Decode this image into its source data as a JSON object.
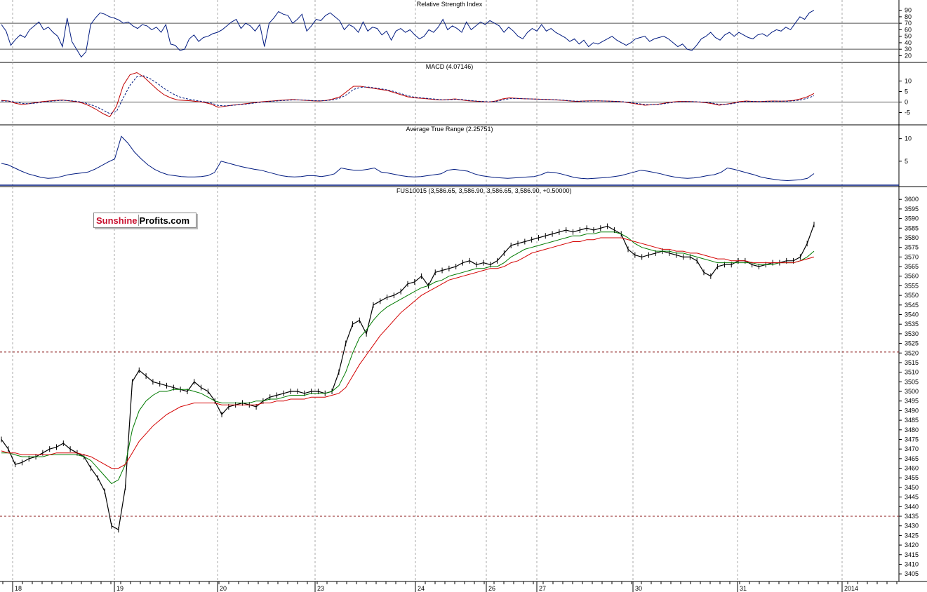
{
  "logo": {
    "part1": "Sunshine",
    "part2": "Profits.com"
  },
  "chart_data": [
    {
      "type": "line",
      "title": "Relative Strength Index",
      "yticks": [
        90,
        80,
        70,
        60,
        50,
        40,
        30,
        20
      ],
      "ylim": [
        14,
        95
      ],
      "reference_lines": [
        70,
        30
      ],
      "series": [
        {
          "values": [
            68,
            58,
            36,
            45,
            52,
            48,
            60,
            66,
            72,
            60,
            64,
            56,
            50,
            34,
            78,
            42,
            30,
            18,
            26,
            68,
            78,
            86,
            84,
            80,
            78,
            75,
            70,
            72,
            66,
            62,
            68,
            66,
            60,
            64,
            56,
            68,
            38,
            36,
            28,
            30,
            46,
            52,
            42,
            48,
            50,
            54,
            56,
            60,
            66,
            72,
            76,
            62,
            70,
            66,
            58,
            68,
            34,
            70,
            78,
            88,
            84,
            82,
            70,
            76,
            84,
            58,
            66,
            76,
            74,
            82,
            86,
            80,
            74,
            60,
            68,
            64,
            56,
            72,
            58,
            64,
            62,
            52,
            58,
            44,
            58,
            62,
            56,
            60,
            52,
            46,
            50,
            60,
            56,
            64,
            76,
            60,
            66,
            62,
            56,
            72,
            60,
            66,
            72,
            68,
            74,
            70,
            66,
            56,
            64,
            58,
            50,
            46,
            56,
            62,
            58,
            68,
            58,
            62,
            56,
            52,
            48,
            42,
            46,
            38,
            44,
            34,
            40,
            38,
            42,
            46,
            50,
            44,
            40,
            36,
            40,
            46,
            48,
            50,
            42,
            46,
            48,
            50,
            46,
            40,
            34,
            38,
            30,
            28,
            36,
            46,
            50,
            56,
            48,
            44,
            52,
            56,
            50,
            56,
            52,
            48,
            46,
            52,
            54,
            50,
            56,
            60,
            58,
            64,
            60,
            70,
            80,
            76,
            86,
            90
          ]
        }
      ]
    },
    {
      "type": "line",
      "title": "MACD (4.07146)",
      "yticks": [
        10,
        5,
        0,
        -5
      ],
      "ylim": [
        -9.5,
        15.5
      ],
      "reference_lines": [
        0
      ],
      "series": [
        {
          "line": "solid",
          "values": [
            0.8,
            0.5,
            -0.5,
            -1.2,
            -0.8,
            -0.3,
            0.2,
            0.5,
            0.8,
            1.0,
            0.6,
            0.2,
            -0.5,
            -1.8,
            -3.5,
            -5.5,
            -7.0,
            -2.0,
            8.0,
            13.0,
            14.0,
            12.0,
            9.0,
            6.0,
            3.5,
            2.0,
            1.0,
            0.8,
            0.6,
            0.2,
            -0.2,
            -1.0,
            -2.5,
            -2.0,
            -1.5,
            -1.2,
            -0.8,
            -0.4,
            0.0,
            0.3,
            0.5,
            0.8,
            1.0,
            1.2,
            1.0,
            0.8,
            0.6,
            0.5,
            0.8,
            1.5,
            2.5,
            5.0,
            7.5,
            7.5,
            7.0,
            6.5,
            6.0,
            5.5,
            4.5,
            3.5,
            2.5,
            2.0,
            1.8,
            1.5,
            1.2,
            1.0,
            1.2,
            1.5,
            1.0,
            0.6,
            0.4,
            0.2,
            0.0,
            0.5,
            1.5,
            2.0,
            1.8,
            1.6,
            1.5,
            1.4,
            1.3,
            1.2,
            1.0,
            0.8,
            0.5,
            0.3,
            0.5,
            0.6,
            0.6,
            0.5,
            0.4,
            0.3,
            0.0,
            -0.5,
            -1.0,
            -1.5,
            -1.3,
            -1.0,
            -0.5,
            0.0,
            0.3,
            0.3,
            0.2,
            0.0,
            -0.3,
            -0.8,
            -1.5,
            -1.0,
            -0.5,
            0.2,
            0.5,
            0.3,
            0.2,
            0.4,
            0.5,
            0.4,
            0.5,
            0.8,
            1.5,
            2.5,
            4.07
          ]
        },
        {
          "line": "dashed",
          "values": [
            0.5,
            0.5,
            0.0,
            -0.6,
            -0.8,
            -0.5,
            -0.1,
            0.3,
            0.6,
            0.8,
            0.7,
            0.4,
            -0.1,
            -1.0,
            -2.2,
            -3.8,
            -5.5,
            -4.5,
            2.0,
            8.0,
            12.0,
            12.5,
            11.0,
            9.0,
            6.5,
            4.5,
            2.8,
            1.8,
            1.2,
            0.6,
            0.1,
            -0.5,
            -1.6,
            -1.8,
            -1.6,
            -1.3,
            -1.0,
            -0.6,
            -0.2,
            0.1,
            0.4,
            0.6,
            0.8,
            1.0,
            1.0,
            0.9,
            0.7,
            0.6,
            0.7,
            1.1,
            1.9,
            3.5,
            6.0,
            7.0,
            7.2,
            6.8,
            6.3,
            5.8,
            5.0,
            4.0,
            3.0,
            2.3,
            2.0,
            1.7,
            1.4,
            1.1,
            1.1,
            1.3,
            1.2,
            0.8,
            0.5,
            0.3,
            0.1,
            0.3,
            1.0,
            1.6,
            1.7,
            1.6,
            1.5,
            1.4,
            1.3,
            1.2,
            1.1,
            0.9,
            0.6,
            0.4,
            0.4,
            0.5,
            0.6,
            0.5,
            0.4,
            0.3,
            0.1,
            -0.3,
            -0.7,
            -1.2,
            -1.3,
            -1.1,
            -0.7,
            -0.2,
            0.1,
            0.2,
            0.2,
            0.1,
            -0.1,
            -0.5,
            -1.1,
            -1.1,
            -0.7,
            -0.1,
            0.3,
            0.3,
            0.2,
            0.3,
            0.4,
            0.4,
            0.4,
            0.6,
            1.0,
            1.8,
            3.0
          ]
        }
      ]
    },
    {
      "type": "line",
      "title": "Average True Range (2.25751)",
      "yticks": [
        10,
        5
      ],
      "ylim": [
        0,
        11.5
      ],
      "series": [
        {
          "values": [
            4.5,
            4.2,
            3.5,
            2.8,
            2.2,
            1.8,
            1.4,
            1.2,
            1.3,
            1.6,
            2.0,
            2.2,
            2.4,
            2.6,
            3.2,
            4.0,
            4.8,
            5.5,
            10.5,
            9.0,
            7.0,
            5.5,
            4.2,
            3.2,
            2.5,
            2.0,
            1.8,
            1.6,
            1.5,
            1.5,
            1.6,
            1.8,
            2.5,
            5.0,
            4.6,
            4.2,
            3.8,
            3.5,
            3.2,
            3.0,
            2.6,
            2.2,
            1.8,
            1.6,
            1.5,
            1.6,
            1.8,
            1.8,
            1.6,
            1.8,
            2.2,
            3.5,
            3.2,
            3.0,
            3.0,
            3.2,
            3.5,
            2.6,
            2.4,
            2.1,
            1.8,
            1.6,
            1.5,
            1.6,
            1.8,
            2.0,
            2.2,
            3.0,
            3.2,
            3.0,
            2.8,
            2.2,
            1.8,
            1.6,
            1.4,
            1.3,
            1.2,
            1.3,
            1.4,
            1.5,
            1.6,
            2.0,
            2.6,
            2.5,
            2.2,
            1.8,
            1.4,
            1.2,
            1.1,
            1.2,
            1.3,
            1.4,
            1.6,
            1.8,
            2.2,
            2.6,
            3.0,
            2.8,
            2.5,
            2.2,
            1.8,
            1.5,
            1.3,
            1.2,
            1.3,
            1.5,
            1.8,
            2.0,
            2.5,
            3.5,
            3.2,
            2.8,
            2.4,
            2.0,
            1.5,
            1.2,
            1.0,
            0.8,
            0.7,
            0.8,
            0.9,
            1.2,
            2.26
          ]
        }
      ]
    },
    {
      "type": "line",
      "title": "FUS10015 (3,586.65, 3,586.90, 3,586.65, 3,586.90, +0.50000)",
      "yticks": [
        3600,
        3595,
        3590,
        3585,
        3580,
        3575,
        3570,
        3565,
        3560,
        3555,
        3550,
        3545,
        3540,
        3535,
        3530,
        3525,
        3520,
        3515,
        3510,
        3505,
        3500,
        3495,
        3490,
        3485,
        3480,
        3475,
        3470,
        3465,
        3460,
        3455,
        3450,
        3445,
        3440,
        3435,
        3430,
        3425,
        3420,
        3415,
        3410,
        3405
      ],
      "ylim": [
        3402.5,
        3603
      ],
      "reference_lines": [
        3520.5,
        3435
      ],
      "categories": [
        "18",
        "19",
        "20",
        "23",
        "24",
        "26",
        "27",
        "30",
        "31",
        "2014"
      ],
      "series": [
        {
          "line": "price",
          "values": [
            3475,
            3470,
            3462,
            3463,
            3465,
            3466,
            3468,
            3470,
            3471,
            3473,
            3470,
            3468,
            3466,
            3460,
            3455,
            3448,
            3430,
            3428,
            3450,
            3505,
            3511,
            3508,
            3505,
            3504,
            3503,
            3502,
            3501,
            3500,
            3505,
            3502,
            3500,
            3495,
            3488,
            3492,
            3493,
            3494,
            3493,
            3492,
            3495,
            3497,
            3498,
            3499,
            3500,
            3500,
            3499,
            3500,
            3500,
            3499,
            3500,
            3510,
            3525,
            3535,
            3537,
            3530,
            3545,
            3547,
            3549,
            3550,
            3552,
            3556,
            3557,
            3560,
            3555,
            3562,
            3563,
            3564,
            3565,
            3567,
            3568,
            3566,
            3567,
            3566,
            3568,
            3572,
            3576,
            3577,
            3578,
            3579,
            3580,
            3581,
            3582,
            3583,
            3584,
            3583,
            3584,
            3585,
            3584,
            3585,
            3586,
            3584,
            3582,
            3574,
            3571,
            3570,
            3571,
            3572,
            3573,
            3572,
            3571,
            3570,
            3570,
            3568,
            3562,
            3560,
            3565,
            3566,
            3566,
            3568,
            3568,
            3566,
            3565,
            3566,
            3567,
            3567,
            3568,
            3568,
            3570,
            3577,
            3586.9
          ]
        },
        {
          "line": "green",
          "values": [
            3468,
            3468,
            3467,
            3466,
            3466,
            3466,
            3466,
            3467,
            3467,
            3467,
            3467,
            3467,
            3466,
            3464,
            3460,
            3456,
            3452,
            3454,
            3462,
            3480,
            3490,
            3495,
            3498,
            3500,
            3500,
            3501,
            3501,
            3501,
            3500,
            3499,
            3497,
            3495,
            3494,
            3494,
            3494,
            3494,
            3494,
            3495,
            3495,
            3496,
            3496,
            3497,
            3498,
            3498,
            3498,
            3499,
            3499,
            3499,
            3500,
            3503,
            3510,
            3520,
            3528,
            3532,
            3537,
            3541,
            3544,
            3546,
            3548,
            3550,
            3552,
            3554,
            3555,
            3557,
            3558,
            3560,
            3561,
            3562,
            3563,
            3564,
            3564,
            3565,
            3565,
            3567,
            3570,
            3572,
            3574,
            3575,
            3576,
            3577,
            3578,
            3579,
            3580,
            3581,
            3581,
            3582,
            3582,
            3583,
            3583,
            3583,
            3582,
            3580,
            3577,
            3575,
            3574,
            3573,
            3573,
            3573,
            3572,
            3572,
            3571,
            3570,
            3569,
            3568,
            3567,
            3567,
            3567,
            3567,
            3567,
            3567,
            3566,
            3566,
            3566,
            3567,
            3567,
            3567,
            3568,
            3570,
            3573
          ]
        },
        {
          "line": "red",
          "values": [
            3469,
            3468,
            3468,
            3467,
            3467,
            3467,
            3467,
            3467,
            3468,
            3468,
            3468,
            3468,
            3467,
            3466,
            3464,
            3462,
            3460,
            3460,
            3462,
            3468,
            3474,
            3478,
            3482,
            3485,
            3488,
            3490,
            3492,
            3493,
            3494,
            3494,
            3494,
            3494,
            3493,
            3493,
            3493,
            3493,
            3493,
            3493,
            3494,
            3494,
            3495,
            3495,
            3496,
            3496,
            3496,
            3497,
            3497,
            3497,
            3498,
            3499,
            3502,
            3508,
            3514,
            3519,
            3524,
            3529,
            3533,
            3537,
            3541,
            3544,
            3547,
            3550,
            3552,
            3554,
            3556,
            3558,
            3559,
            3560,
            3561,
            3562,
            3563,
            3564,
            3564,
            3565,
            3567,
            3568,
            3570,
            3572,
            3573,
            3574,
            3575,
            3576,
            3577,
            3578,
            3578,
            3579,
            3579,
            3580,
            3580,
            3580,
            3580,
            3579,
            3578,
            3577,
            3576,
            3575,
            3574,
            3574,
            3573,
            3573,
            3572,
            3572,
            3571,
            3570,
            3569,
            3569,
            3568,
            3568,
            3568,
            3567,
            3567,
            3567,
            3567,
            3567,
            3567,
            3567,
            3568,
            3569,
            3570
          ]
        }
      ]
    }
  ]
}
